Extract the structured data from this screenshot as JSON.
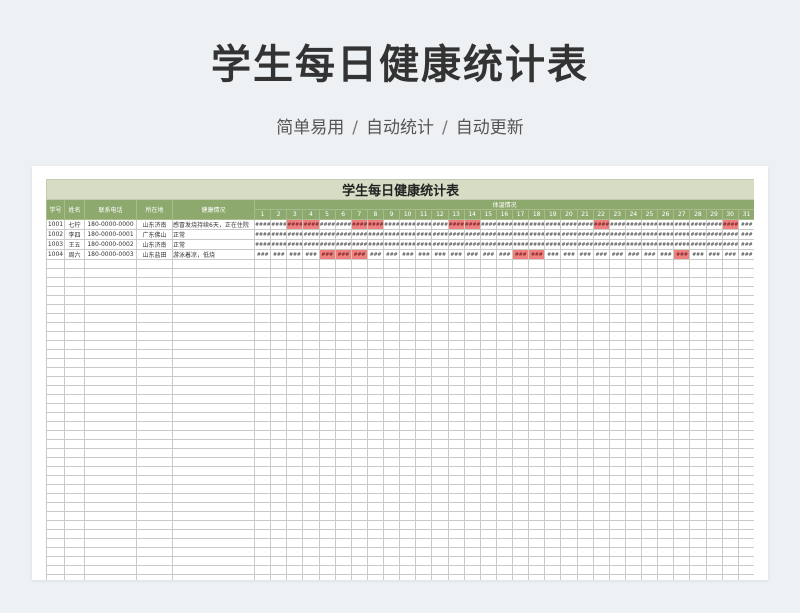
{
  "banner": {
    "title": "学生每日健康统计表",
    "tags": [
      "简单易用",
      "自动统计",
      "自动更新"
    ],
    "separator": "/"
  },
  "sheet": {
    "title": "学生每日健康统计表",
    "headers": {
      "id": "学号",
      "name": "姓名",
      "phone": "联系电话",
      "location": "所在地",
      "health": "健康情况",
      "temperature": "体温情况"
    },
    "days": [
      "1",
      "2",
      "3",
      "4",
      "5",
      "6",
      "7",
      "8",
      "9",
      "10",
      "11",
      "12",
      "13",
      "14",
      "15",
      "16",
      "17",
      "18",
      "19",
      "20",
      "21",
      "22",
      "23",
      "24",
      "25",
      "26",
      "27",
      "28",
      "29",
      "30",
      "31"
    ],
    "overflow_marker": "###",
    "rows": [
      {
        "id": "1001",
        "name": "七柠",
        "phone": "180-0000-0000",
        "location": "山东济南",
        "health": "感冒发烧持续6天，正在住院",
        "cells": [
          "####",
          "####",
          "####",
          "####",
          "####",
          "####",
          "####",
          "####",
          "####",
          "####",
          "####",
          "####",
          "####",
          "####",
          "####",
          "####",
          "####",
          "####",
          "####",
          "####",
          "####",
          "####",
          "####",
          "####",
          "####",
          "####",
          "####",
          "####",
          "####",
          "####",
          "###"
        ],
        "hot_days": [
          3,
          4,
          7,
          8,
          13,
          14,
          22,
          30
        ]
      },
      {
        "id": "1002",
        "name": "李四",
        "phone": "180-0000-0001",
        "location": "广东佛山",
        "health": "正常",
        "cells": [
          "####",
          "####",
          "####",
          "####",
          "####",
          "####",
          "####",
          "####",
          "####",
          "####",
          "####",
          "####",
          "####",
          "####",
          "####",
          "####",
          "####",
          "####",
          "####",
          "####",
          "####",
          "####",
          "####",
          "####",
          "####",
          "####",
          "####",
          "####",
          "####",
          "####",
          "###"
        ],
        "hot_days": []
      },
      {
        "id": "1003",
        "name": "王五",
        "phone": "180-0000-0002",
        "location": "山东济南",
        "health": "正常",
        "cells": [
          "####",
          "####",
          "####",
          "####",
          "####",
          "####",
          "####",
          "####",
          "####",
          "####",
          "####",
          "####",
          "####",
          "####",
          "####",
          "####",
          "####",
          "####",
          "####",
          "####",
          "####",
          "####",
          "####",
          "####",
          "####",
          "####",
          "####",
          "####",
          "####",
          "####",
          "###"
        ],
        "hot_days": []
      },
      {
        "id": "1004",
        "name": "周六",
        "phone": "180-0000-0003",
        "location": "山东盐田",
        "health": "游泳着凉，低烧",
        "cells": [
          "###",
          "###",
          "###",
          "###",
          "###",
          "###",
          "###",
          "###",
          "###",
          "###",
          "###",
          "###",
          "###",
          "###",
          "###",
          "###",
          "###",
          "###",
          "###",
          "###",
          "###",
          "###",
          "###",
          "###",
          "###",
          "###",
          "###",
          "###",
          "###",
          "###",
          "###"
        ],
        "hot_days": [
          5,
          6,
          7,
          17,
          18,
          27
        ]
      }
    ]
  },
  "colors": {
    "header_green": "#8ea96e",
    "title_band": "#d6ddc4",
    "alert_red": "#f08080"
  }
}
